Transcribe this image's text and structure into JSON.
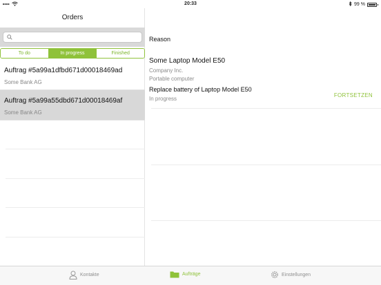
{
  "statusbar": {
    "time": "20:33",
    "battery": "99 %",
    "battery_level": 0.99
  },
  "left": {
    "title": "Orders",
    "search": {
      "placeholder": ""
    },
    "segments": [
      "To do",
      "In progress",
      "Finished"
    ],
    "active_segment": 1,
    "orders": [
      {
        "title": "Auftrag #5a99a1dfbd671d00018469ad",
        "subtitle": "Some Bank AG"
      },
      {
        "title": "Auftrag #5a99a55dbd671d00018469af",
        "subtitle": "Some Bank AG"
      }
    ]
  },
  "detail": {
    "reason_label": "Reason",
    "model": "Some Laptop Model E50",
    "company": "Company Inc.",
    "category": "Portable computer",
    "task": "Replace battery of Laptop Model E50",
    "status": "In progress",
    "action": "FORTSETZEN"
  },
  "tabs": [
    {
      "label": "Kontakte",
      "icon": "person-icon"
    },
    {
      "label": "Aufträge",
      "icon": "folder-icon"
    },
    {
      "label": "Einstellungen",
      "icon": "gear-icon"
    }
  ],
  "colors": {
    "accent": "#8fc23a",
    "selected_row": "#d8d8d8"
  }
}
